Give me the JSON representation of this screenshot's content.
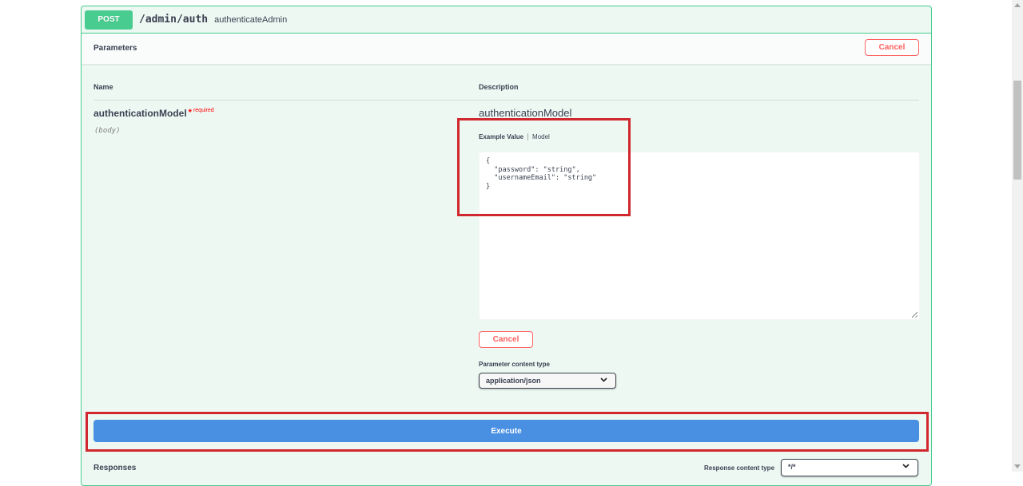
{
  "operation": {
    "method": "POST",
    "path": "/admin/auth",
    "summary": "authenticateAdmin"
  },
  "parameters_section": {
    "title": "Parameters",
    "cancel_label": "Cancel",
    "col_name": "Name",
    "col_description": "Description"
  },
  "parameter": {
    "name": "authenticationModel",
    "required_star": "*",
    "required_text": "required",
    "location": "(body)",
    "description": "authenticationModel",
    "tab_example": "Example Value",
    "tab_model": "Model",
    "body_value": "{\n  \"password\": \"string\",\n  \"usernameEmail\": \"string\"\n}",
    "cancel_label": "Cancel",
    "content_type_label": "Parameter content type",
    "content_type_value": "application/json"
  },
  "execute": {
    "label": "Execute"
  },
  "responses": {
    "title": "Responses",
    "content_type_label": "Response content type",
    "content_type_value": "*/*"
  },
  "colors": {
    "post_accent": "#49cc90",
    "execute_blue": "#4990e2",
    "cancel_red": "#ff6060",
    "highlight_red": "#d0282e"
  },
  "icons": {
    "dropdown": "chevron-down-icon"
  }
}
